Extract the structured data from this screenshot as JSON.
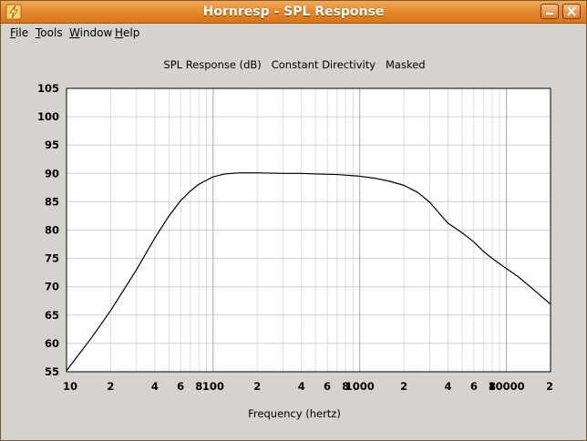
{
  "window": {
    "title": "Hornresp - SPL Response",
    "accent_color": "#e58a2c"
  },
  "menu": {
    "items": [
      {
        "name": "file",
        "mnemonic": "F",
        "rest": "ile"
      },
      {
        "name": "tools",
        "mnemonic": "T",
        "rest": "ools"
      },
      {
        "name": "window",
        "mnemonic": "W",
        "rest": "indow"
      },
      {
        "name": "help",
        "mnemonic": "H",
        "rest": "elp"
      }
    ]
  },
  "controls": {
    "minimize_icon": "minimize-icon",
    "close_icon": "close-icon"
  },
  "chart_data": {
    "type": "line",
    "title": "SPL Response (dB)   Constant Directivity   Masked",
    "xlabel": "Frequency (hertz)",
    "ylabel": "",
    "x_scale": "log",
    "xlim": [
      10,
      20000
    ],
    "ylim": [
      55,
      105
    ],
    "y_ticks": [
      55,
      60,
      65,
      70,
      75,
      80,
      85,
      90,
      95,
      100,
      105
    ],
    "x_tick_labels": [
      {
        "value": 10,
        "label": "10"
      },
      {
        "value": 20,
        "label": "2"
      },
      {
        "value": 40,
        "label": "4"
      },
      {
        "value": 60,
        "label": "6"
      },
      {
        "value": 80,
        "label": "8"
      },
      {
        "value": 100,
        "label": "100"
      },
      {
        "value": 200,
        "label": "2"
      },
      {
        "value": 400,
        "label": "4"
      },
      {
        "value": 600,
        "label": "6"
      },
      {
        "value": 800,
        "label": "8"
      },
      {
        "value": 1000,
        "label": "1000"
      },
      {
        "value": 2000,
        "label": "2"
      },
      {
        "value": 4000,
        "label": "4"
      },
      {
        "value": 6000,
        "label": "6"
      },
      {
        "value": 8000,
        "label": "8"
      },
      {
        "value": 10000,
        "label": "10000"
      },
      {
        "value": 20000,
        "label": "2"
      }
    ],
    "grid": true,
    "series": [
      {
        "color": "#000000",
        "x": [
          10,
          15,
          20,
          30,
          40,
          50,
          60,
          70,
          80,
          100,
          120,
          150,
          200,
          300,
          400,
          500,
          700,
          1000,
          1300,
          1600,
          2000,
          2500,
          3000,
          3500,
          4000,
          5000,
          6000,
          7000,
          8000,
          10000,
          12000,
          15000,
          20000
        ],
        "y": [
          55.2,
          61.2,
          65.8,
          73.0,
          78.6,
          82.5,
          85.2,
          86.9,
          88.1,
          89.4,
          89.9,
          90.1,
          90.1,
          90.0,
          90.0,
          89.9,
          89.8,
          89.5,
          89.1,
          88.6,
          87.9,
          86.6,
          84.9,
          82.9,
          81.2,
          79.5,
          77.9,
          76.2,
          75.0,
          73.2,
          71.8,
          69.7,
          66.9
        ]
      }
    ]
  }
}
